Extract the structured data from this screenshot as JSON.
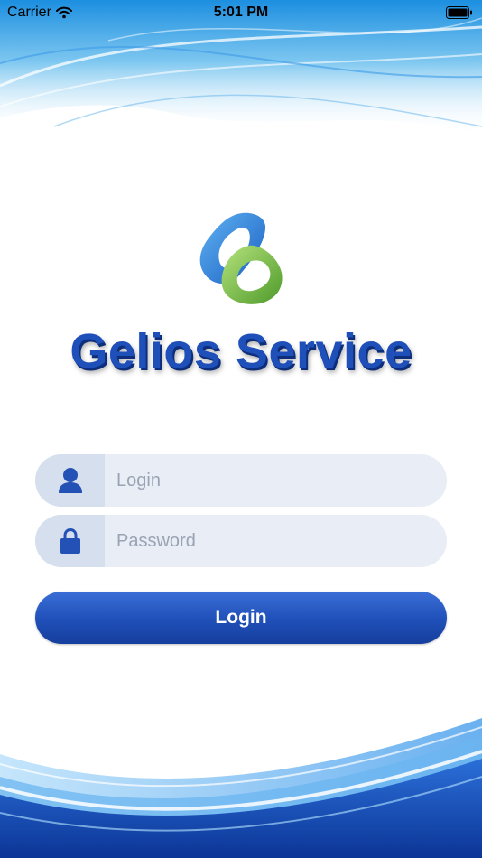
{
  "status_bar": {
    "carrier": "Carrier",
    "time": "5:01 PM",
    "icons": [
      "wifi-icon",
      "battery-icon"
    ]
  },
  "brand": {
    "name": "Gelios Service",
    "logo_icon": "gelios-logo-icon"
  },
  "form": {
    "login_placeholder": "Login",
    "password_placeholder": "Password",
    "login_value": "",
    "password_value": "",
    "login_icon": "user-icon",
    "password_icon": "lock-icon",
    "submit_label": "Login"
  },
  "colors": {
    "accent": "#1f4fb8",
    "field_background": "#e8edf6",
    "logo_blue": "#2a7ed8",
    "logo_green": "#6ab43a"
  }
}
